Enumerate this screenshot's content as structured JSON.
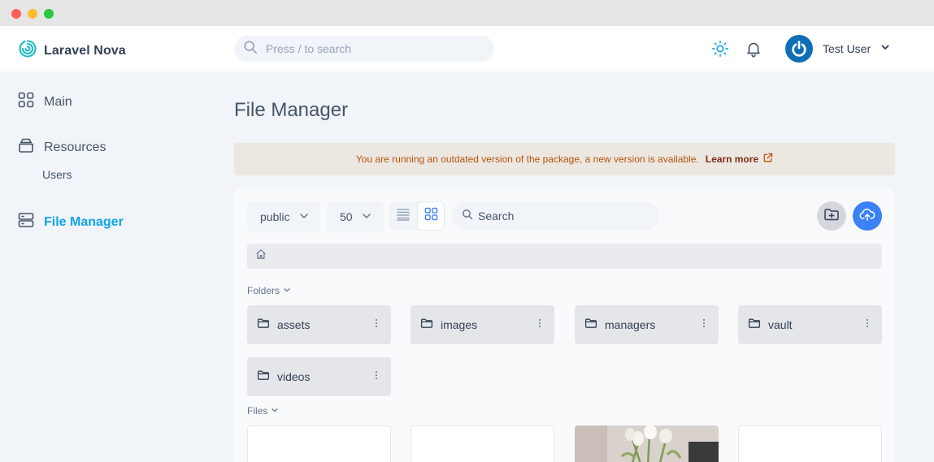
{
  "header": {
    "brand": "Laravel Nova",
    "search_placeholder": "Press / to search",
    "user_name": "Test User"
  },
  "sidebar": {
    "items": [
      {
        "label": "Main",
        "icon": "grid-icon"
      },
      {
        "label": "Resources",
        "icon": "database-icon"
      },
      {
        "label": "Users"
      },
      {
        "label": "File Manager",
        "icon": "server-icon",
        "active": true
      }
    ]
  },
  "main": {
    "title": "File Manager",
    "alert": {
      "message": "You are running an outdated version of the package, a new version is available.",
      "link": "Learn more"
    },
    "toolbar": {
      "disk": "public",
      "per_page": "50",
      "search_placeholder": "Search"
    },
    "folders_label": "Folders",
    "folders": [
      "assets",
      "images",
      "managers",
      "vault",
      "videos"
    ],
    "files_label": "Files"
  },
  "colors": {
    "accent": "#0ea5e9",
    "primary_button": "#3b82f6",
    "alert_bg": "#ede7e2",
    "alert_text": "#b45309"
  }
}
